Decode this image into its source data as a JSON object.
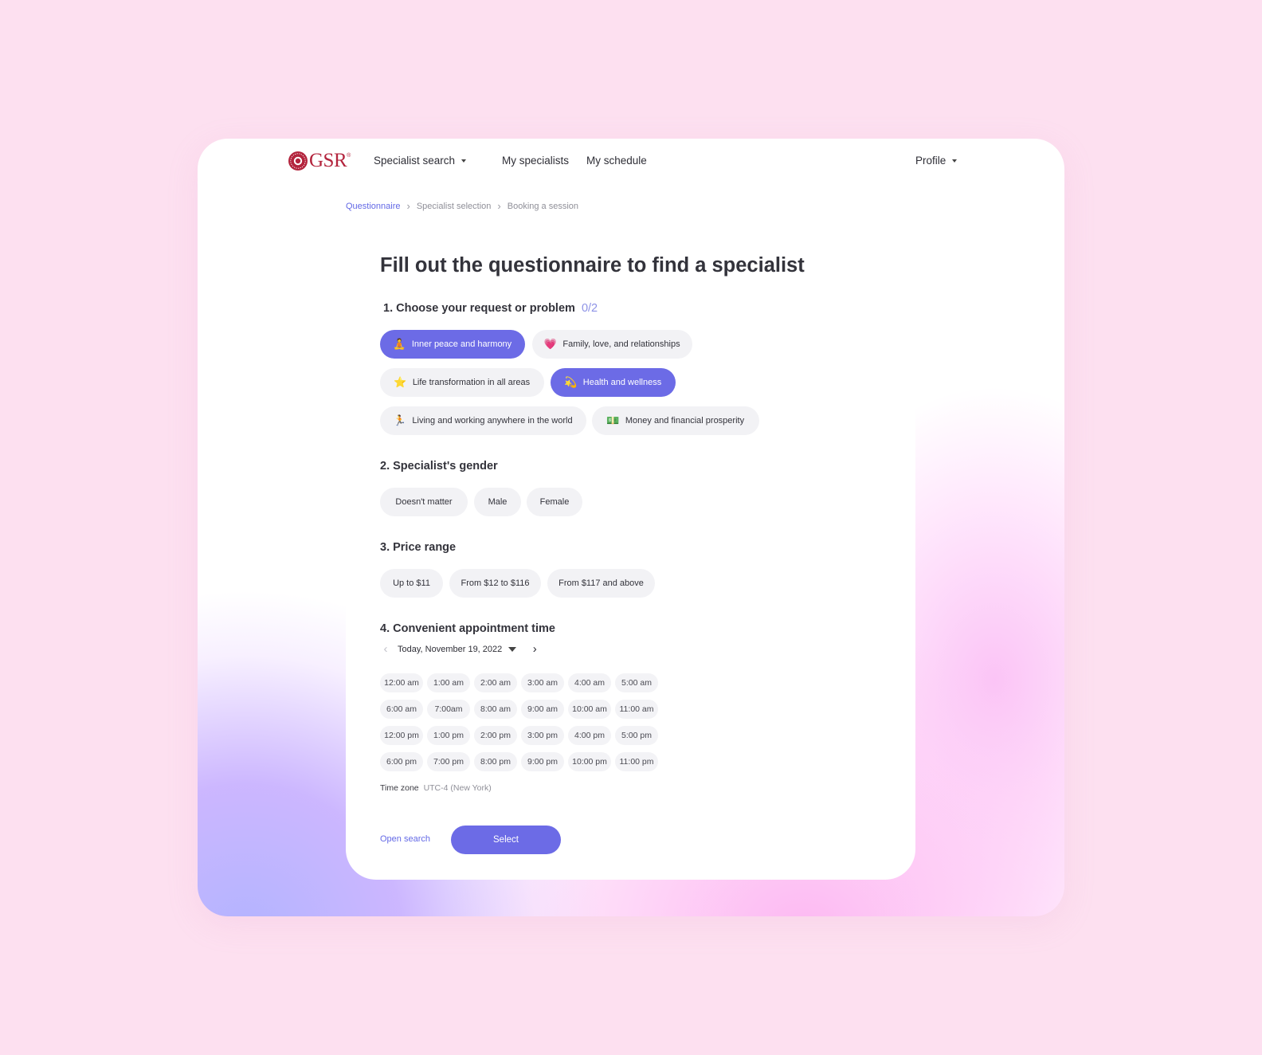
{
  "logo": {
    "text": "GSR",
    "reg": "®"
  },
  "nav": {
    "specialist_search": "Specialist search",
    "my_specialists": "My specialists",
    "my_schedule": "My schedule",
    "profile": "Profile"
  },
  "breadcrumb": [
    "Questionnaire",
    "Specialist selection",
    "Booking a session"
  ],
  "title": "Fill out the questionnaire to find a specialist",
  "section1": {
    "number": "1.",
    "label": "Choose your request or problem",
    "counter": "0/2",
    "chips": [
      {
        "emoji": "🧘",
        "label": "Inner peace and harmony",
        "selected": true
      },
      {
        "emoji": "💗",
        "label": "Family, love, and relationships",
        "selected": false
      },
      {
        "emoji": "⭐",
        "label": "Life transformation in all areas",
        "selected": false
      },
      {
        "emoji": "💫",
        "label": "Health and wellness",
        "selected": true
      },
      {
        "emoji": "🏃",
        "label": "Living and working anywhere in the world",
        "selected": false
      },
      {
        "emoji": "💵",
        "label": "Money and financial prosperity",
        "selected": false
      }
    ]
  },
  "section2": {
    "label": "2. Specialist's gender",
    "options": [
      "Doesn't matter",
      "Male",
      "Female"
    ]
  },
  "section3": {
    "label": "3. Price range",
    "options": [
      "Up to $11",
      "From $12 to $116",
      "From $117 and above"
    ]
  },
  "section4": {
    "label": "4. Convenient appointment time",
    "date": "Today, November 19, 2022",
    "slots": [
      "12:00 am",
      "1:00 am",
      "2:00 am",
      "3:00 am",
      "4:00 am",
      "5:00 am",
      "6:00 am",
      "7:00am",
      "8:00 am",
      "9:00 am",
      "10:00 am",
      "11:00 am",
      "12:00 pm",
      "1:00 pm",
      "2:00 pm",
      "3:00 pm",
      "4:00 pm",
      "5:00 pm",
      "6:00 pm",
      "7:00 pm",
      "8:00 pm",
      "9:00 pm",
      "10:00 pm",
      "11:00 pm"
    ],
    "timezone_label": "Time zone",
    "timezone_value": "UTC-4 (New York)"
  },
  "actions": {
    "open_search": "Open search",
    "select": "Select"
  },
  "colors": {
    "accent": "#6c6be6",
    "brand": "#b3243d",
    "chip_bg": "#f2f2f5"
  }
}
